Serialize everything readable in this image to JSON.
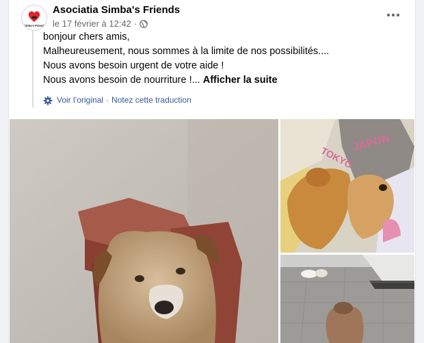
{
  "post": {
    "author": "Asociatia Simba's Friends",
    "avatar_caption": "Simba's Friends",
    "timestamp": "le 17 février à 12:42",
    "separator": "·",
    "privacy_icon": "globe-icon",
    "more_icon": "more-options-icon",
    "text_lines": [
      "bonjour chers amis,",
      "Malheureusement, nous sommes à la limite de nos possibilités....",
      "Nous avons besoin urgent de votre aide !",
      "Nous avons besoin de nourriture !..."
    ],
    "see_more": "Afficher la suite",
    "translation": {
      "view_original": "Voir l’original",
      "separator": "·",
      "rate": "Notez cette traduction"
    },
    "photo_texts": {
      "pillow_1": "JAPON",
      "pillow_2": "TOKYO"
    }
  },
  "colors": {
    "link": "#385898",
    "secondary_text": "#65676b",
    "primary_text": "#050505",
    "logo_red": "#e0242c"
  }
}
